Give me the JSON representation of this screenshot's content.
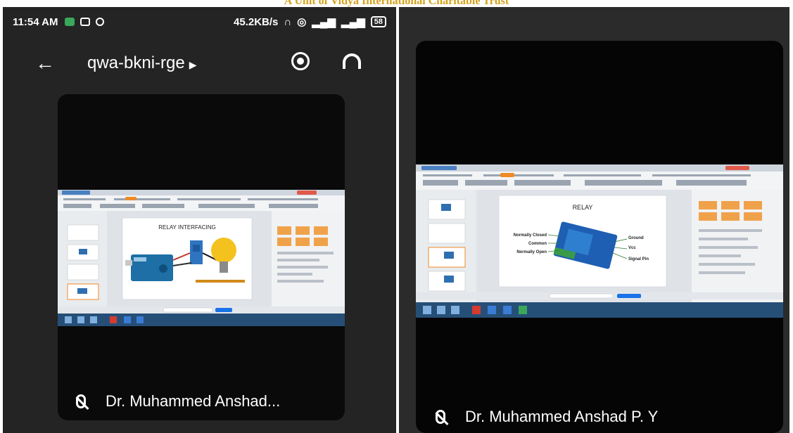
{
  "banner_text": "A Unit of Vidya International Charitable Trust",
  "left": {
    "status": {
      "time": "11:54 AM",
      "net": "45.2KB/s",
      "battery": "58"
    },
    "meeting_code": "qwa-bkni-rge",
    "slide_title": "RELAY INTERFACING",
    "participant": "Dr. Muhammed Anshad..."
  },
  "right": {
    "slide_title": "RELAY",
    "pins_left": [
      "Normally Closed",
      "Common",
      "Normally Open"
    ],
    "pins_right": [
      "Ground",
      "Vcc",
      "Signal Pin"
    ],
    "participant": "Dr. Muhammed Anshad P. Y"
  },
  "colors": {
    "accent": "#1a73e8",
    "tile": "#0a0a0a"
  }
}
